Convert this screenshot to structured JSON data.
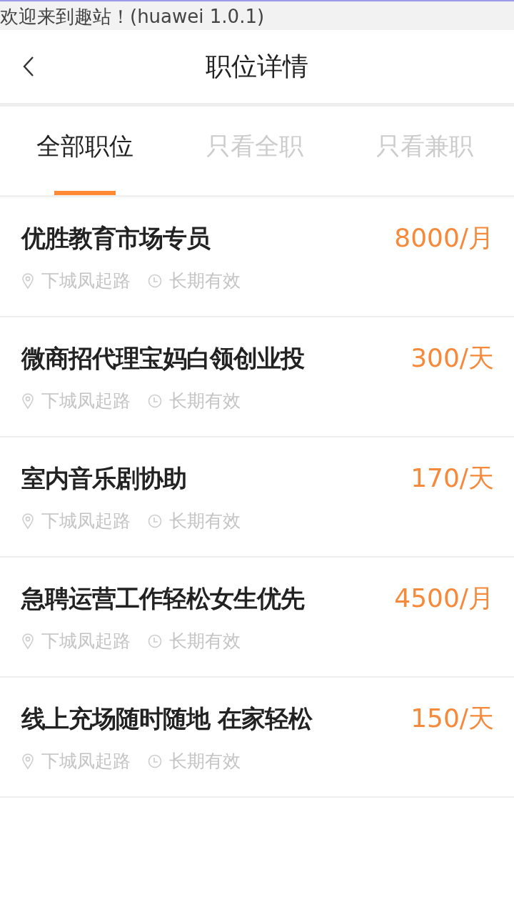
{
  "status_bar": {
    "text": "欢迎来到趣站！(huawei 1.0.1)"
  },
  "header": {
    "title": "职位详情"
  },
  "tabs": [
    {
      "label": "全部职位",
      "selected": true
    },
    {
      "label": "只看全职",
      "selected": false
    },
    {
      "label": "只看兼职",
      "selected": false
    }
  ],
  "jobs": [
    {
      "title": "优胜教育市场专员",
      "salary": "8000/月",
      "location": "下城凤起路",
      "validity": "长期有效"
    },
    {
      "title": "微商招代理宝妈白领创业投",
      "salary": "300/天",
      "location": "下城凤起路",
      "validity": "长期有效"
    },
    {
      "title": "室内音乐剧协助",
      "salary": "170/天",
      "location": "下城凤起路",
      "validity": "长期有效"
    },
    {
      "title": "急聘运营工作轻松女生优先",
      "salary": "4500/月",
      "location": "下城凤起路",
      "validity": "长期有效"
    },
    {
      "title": "线上充场随时随地 在家轻松",
      "salary": "150/天",
      "location": "下城凤起路",
      "validity": "长期有效"
    }
  ]
}
